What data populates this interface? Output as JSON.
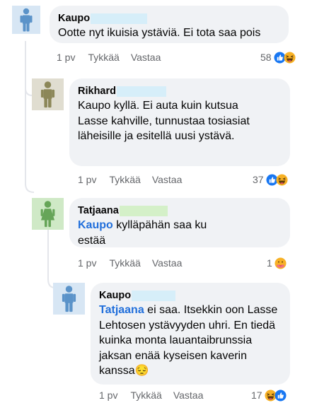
{
  "comments": [
    {
      "name": "Kaupo",
      "text": "Ootte nyt ikuisia ystäviä. Ei tota saa pois",
      "time": "1 pv",
      "like_label": "Tykkää",
      "reply_label": "Vastaa",
      "reaction_count": "58",
      "reactions": [
        "like-icon",
        "laugh-icon"
      ],
      "avatar_color": "#5b93c9"
    },
    {
      "name": "Rikhard",
      "text": "Kaupo kyllä. Ei auta kuin kutsua Lasse kahville, tunnustaa tosiasiat läheisille ja esitellä uusi ystävä.",
      "time": "1 pv",
      "like_label": "Tykkää",
      "reply_label": "Vastaa",
      "reaction_count": "37",
      "reactions": [
        "like-icon",
        "laugh-icon"
      ],
      "avatar_color": "#8c8758"
    },
    {
      "name": "Tatjaana",
      "mention": "Kaupo",
      "text": " kylläpähän saa ku estää",
      "time": "1 pv",
      "like_label": "Tykkää",
      "reply_label": "Vastaa",
      "reaction_count": "1",
      "reactions": [
        "care-icon"
      ],
      "avatar_color": "#66a558"
    },
    {
      "name": "Kaupo",
      "mention": "Tatjaana",
      "text": " ei saa. Itsekkin oon Lasse Lehtosen ystävyyden uhri. En tiedä kuinka monta lauantaibrunssia jaksan enää kyseisen kaverin kanssa",
      "emoji": "😔",
      "time": "1 pv",
      "like_label": "Tykkää",
      "reply_label": "Vastaa",
      "reaction_count": "17",
      "reactions": [
        "laugh-icon",
        "like-icon"
      ],
      "avatar_color": "#5b93c9"
    }
  ],
  "colors": {
    "bubble": "#f0f2f5",
    "mention": "#216fdb",
    "meta": "#65676b",
    "redaction": "#d6eef9",
    "like_blue": "#1877f2",
    "laugh_yellow": "#f7b125"
  }
}
